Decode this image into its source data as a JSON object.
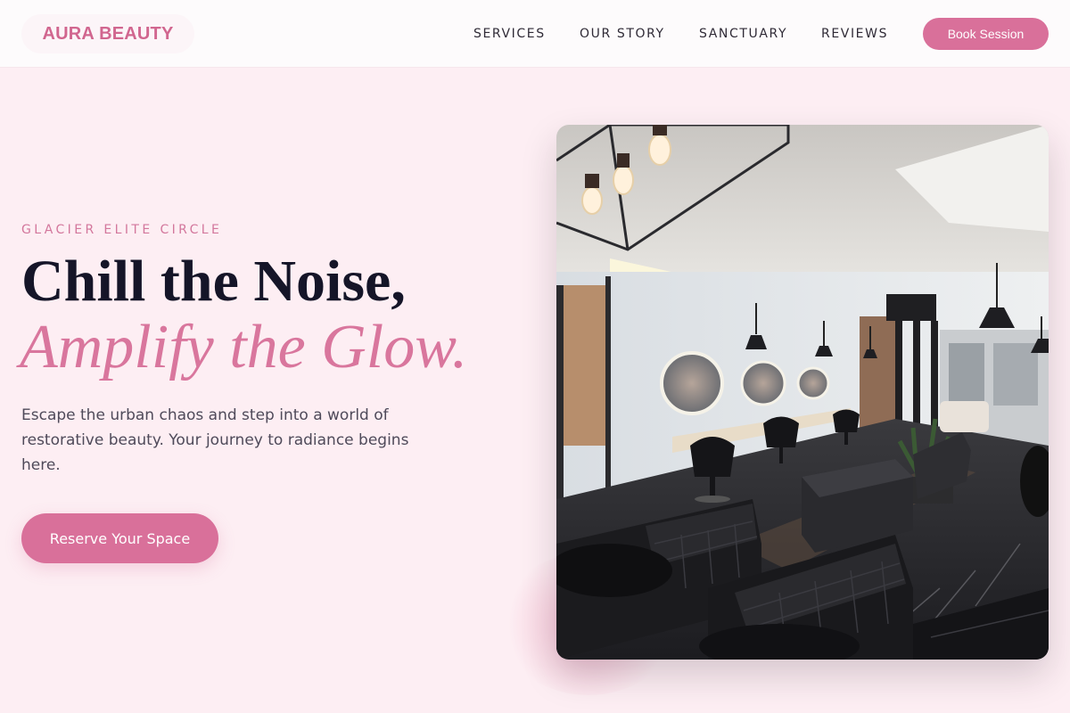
{
  "brand": {
    "name": "AURA BEAUTY",
    "accent": "#d9709a"
  },
  "nav": {
    "items": [
      {
        "label": "SERVICES"
      },
      {
        "label": "OUR STORY"
      },
      {
        "label": "SANCTUARY"
      },
      {
        "label": "REVIEWS"
      }
    ],
    "cta_label": "Book Session"
  },
  "hero": {
    "eyebrow": "GLACIER ELITE CIRCLE",
    "title_line1": "Chill the Noise,",
    "title_line2": "Amplify the Glow.",
    "subtitle": "Escape the urban chaos and step into a world of restorative beauty. Your journey to radiance begins here.",
    "cta_label": "Reserve Your Space",
    "image_alt": "salon-interior-photo"
  }
}
